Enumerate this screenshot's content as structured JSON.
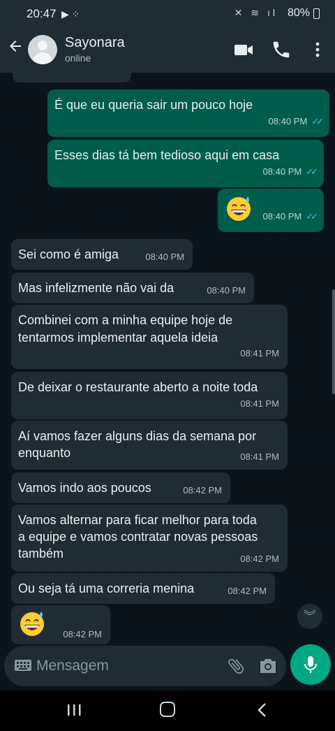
{
  "status_bar": {
    "time": "20:47",
    "battery": "80%"
  },
  "header": {
    "contact_name": "Sayonara",
    "contact_status": "online"
  },
  "messages": [
    {
      "dir": "out",
      "text": "É que eu queria sair um pouco hoje",
      "time": "08:40 PM"
    },
    {
      "dir": "out",
      "text": "Esses dias tá bem tedioso aqui em casa",
      "time": "08:40 PM"
    },
    {
      "dir": "out",
      "emoji": "grinning-sweat-emoji",
      "time": "08:40 PM"
    },
    {
      "dir": "in",
      "text": "Sei como é amiga",
      "time": "08:40 PM"
    },
    {
      "dir": "in",
      "text": "Mas infelizmente não vai da",
      "time": "08:40 PM"
    },
    {
      "dir": "in",
      "lines": [
        "Combinei com a minha equipe hoje de",
        "tentarmos implementar aquela ideia"
      ],
      "time": "08:41 PM"
    },
    {
      "dir": "in",
      "text": "De deixar o restaurante aberto a noite toda",
      "time": "08:41 PM"
    },
    {
      "dir": "in",
      "lines": [
        "Aí vamos fazer alguns dias da semana por",
        "enquanto"
      ],
      "time": "08:41 PM"
    },
    {
      "dir": "in",
      "text": "Vamos indo aos poucos",
      "time": "08:42 PM"
    },
    {
      "dir": "in",
      "lines": [
        "Vamos alternar para ficar melhor para toda",
        "a equipe e vamos contratar novas pessoas",
        "também"
      ],
      "time": "08:42 PM"
    },
    {
      "dir": "in",
      "text": "Ou seja tá uma correria menina",
      "time": "08:42 PM"
    },
    {
      "dir": "in",
      "emoji": "grinning-sweat-emoji",
      "time": "08:42 PM"
    }
  ],
  "input": {
    "placeholder": "Mensagem"
  },
  "colors": {
    "outgoing_bubble": "#005c4b",
    "incoming_bubble": "#202c33",
    "read_ticks": "#53bdeb",
    "accent": "#00a884"
  }
}
